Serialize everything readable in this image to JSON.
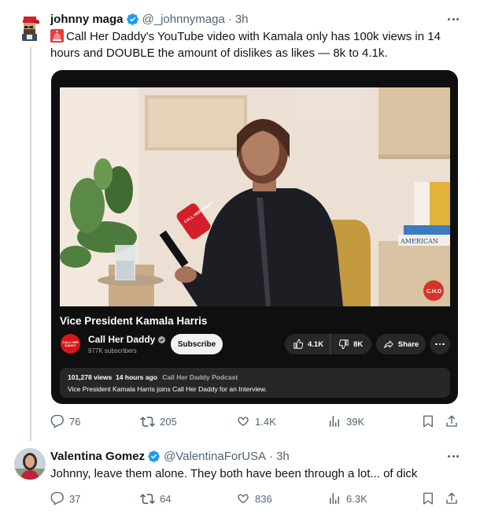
{
  "tweet": {
    "author_name": "johnny maga",
    "author_handle": "@_johnnymaga",
    "time": "3h",
    "dot": "·",
    "text": "Call Her Daddy's YouTube video with Kamala only has 100k views in 14 hours and DOUBLE the amount of dislikes as likes — 8k to 4.1k.",
    "leading_emoji": "siren-emoji",
    "video": {
      "title": "Vice President Kamala Harris",
      "channel_name": "Call Her Daddy",
      "channel_logo_text": "CALL HER DADDY",
      "subscribers": "977K subscribers",
      "subscribe_label": "Subscribe",
      "likes": "4.1K",
      "dislikes": "8K",
      "share_label": "Share",
      "views": "101,278 views",
      "posted": "14 hours ago",
      "podcast_tag": "Call Her Daddy Podcast",
      "description": "Vice President Kamala Harris joins Call Her Daddy for an Interview.",
      "mic_label": "CALL HER DADDY",
      "watermark": "C.H.D",
      "book_title": "AMERICAN"
    },
    "stats": {
      "replies": "76",
      "reposts": "205",
      "likes": "1.4K",
      "views": "39K"
    }
  },
  "reply": {
    "author_name": "Valentina Gomez",
    "author_handle": "@ValentinaForUSA",
    "time": "3h",
    "dot": "·",
    "text": "Johnny, leave them alone. They both have been through a lot... of dick",
    "stats": {
      "replies": "37",
      "reposts": "64",
      "likes": "836",
      "views": "6.3K"
    }
  },
  "colors": {
    "text_primary": "#0f1419",
    "text_secondary": "#536471",
    "verified_blue": "#1d9bf0",
    "thread_line": "#cfd9de",
    "yt_card_bg": "#0f0f0f",
    "yt_pill": "#272727",
    "youtube_red": "#d4191c"
  },
  "icons": [
    "reply-icon",
    "repost-icon",
    "like-icon",
    "views-icon",
    "bookmark-icon",
    "share-icon",
    "more-icon",
    "verified-icon",
    "thumbs-up-icon",
    "thumbs-down-icon"
  ]
}
